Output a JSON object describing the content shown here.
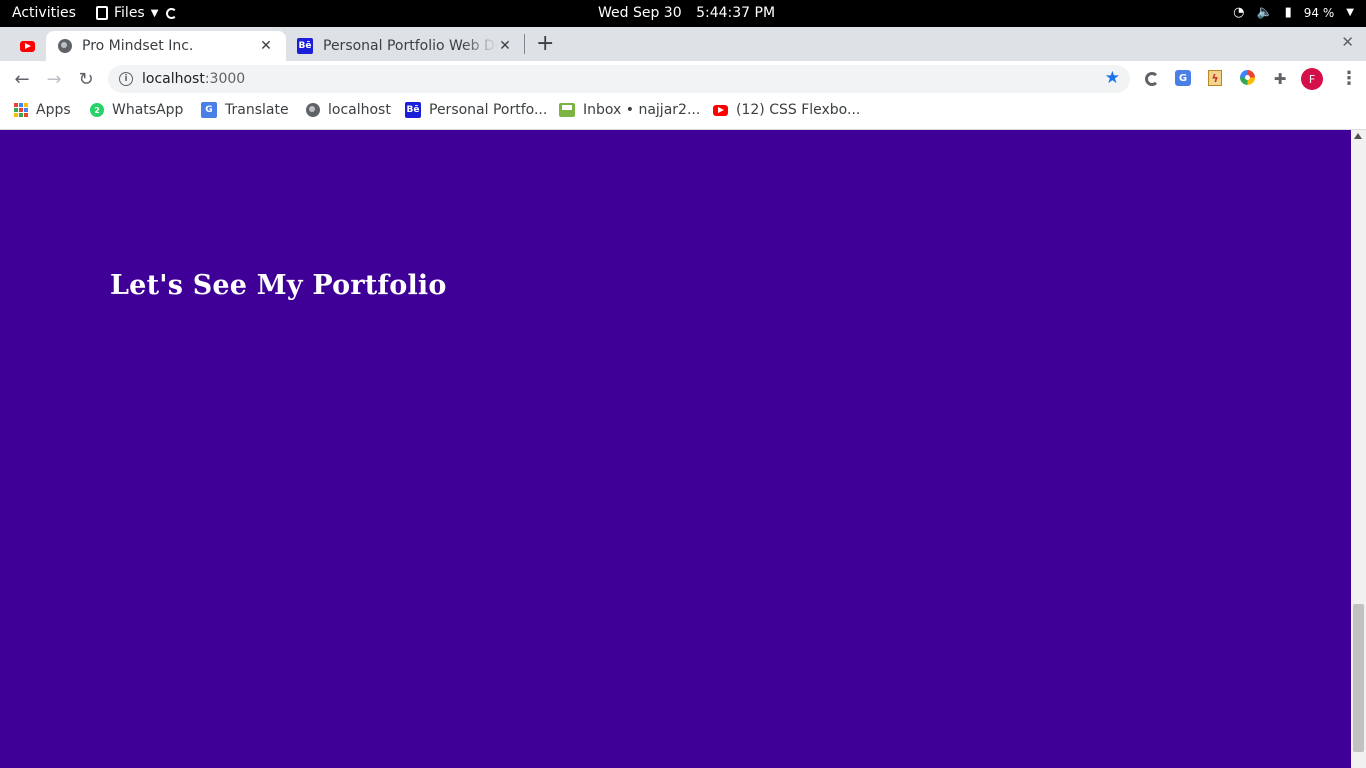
{
  "system_bar": {
    "activities": "Activities",
    "files_menu": "Files",
    "date": "Wed Sep 30",
    "time": "5:44:37 PM",
    "battery": "94 %"
  },
  "browser": {
    "tabs": [
      {
        "type": "pinned",
        "icon": "youtube-icon"
      },
      {
        "title": "Pro Mindset Inc.",
        "icon": "globe-icon",
        "active": true
      },
      {
        "title": "Personal Portfolio Web De",
        "icon": "behance-icon",
        "active": false
      }
    ],
    "address_bar": {
      "host": "localhost",
      "port": ":3000"
    },
    "bookmarks": [
      {
        "label": "Apps",
        "icon": "apps-grid-icon"
      },
      {
        "label": "WhatsApp",
        "icon": "whatsapp-icon"
      },
      {
        "label": "Translate",
        "icon": "translate-icon"
      },
      {
        "label": "localhost",
        "icon": "globe-icon"
      },
      {
        "label": "Personal Portfo...",
        "icon": "behance-icon"
      },
      {
        "label": "Inbox • najjar2...",
        "icon": "inbox-icon"
      },
      {
        "label": "(12) CSS Flexbo...",
        "icon": "youtube-icon"
      }
    ],
    "profile_initial": "F"
  },
  "page": {
    "heading": "Let's See My Portfolio",
    "background_color": "#3e0096"
  },
  "colors": {
    "accent": "#1a73e8",
    "avatar": "#d50f4a"
  }
}
